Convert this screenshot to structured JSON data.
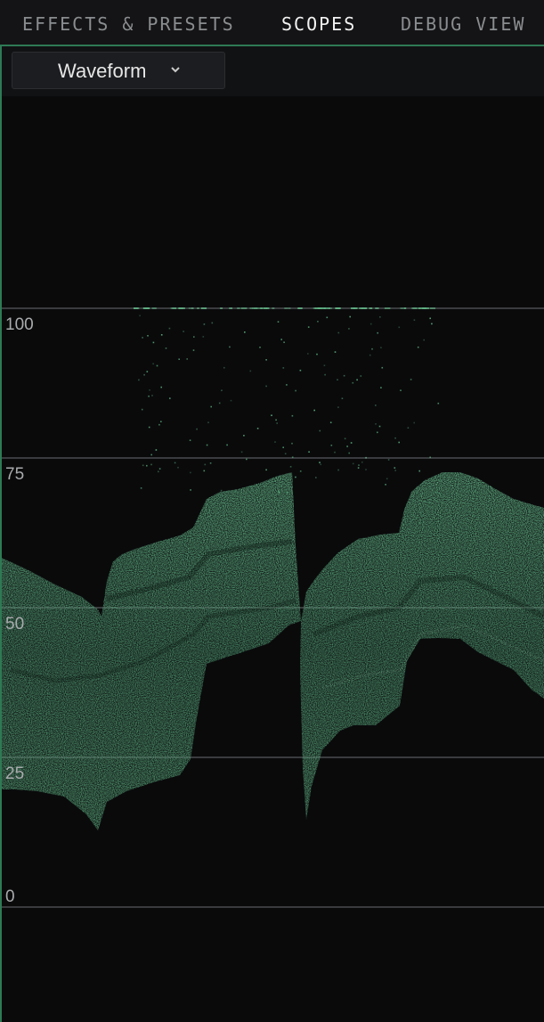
{
  "tabs": [
    {
      "label": "EFFECTS & PRESETS",
      "active": false
    },
    {
      "label": "SCOPES",
      "active": true
    },
    {
      "label": "DEBUG VIEW",
      "active": false
    }
  ],
  "scope_selector": {
    "value": "Waveform",
    "icon": "chevron-down-icon"
  },
  "scale": {
    "ticks": [
      "100",
      "75",
      "50",
      "25",
      "0"
    ]
  },
  "colors": {
    "accent": "#2e7a55",
    "waveform": "#5fb383",
    "background": "#0a0a0b"
  }
}
